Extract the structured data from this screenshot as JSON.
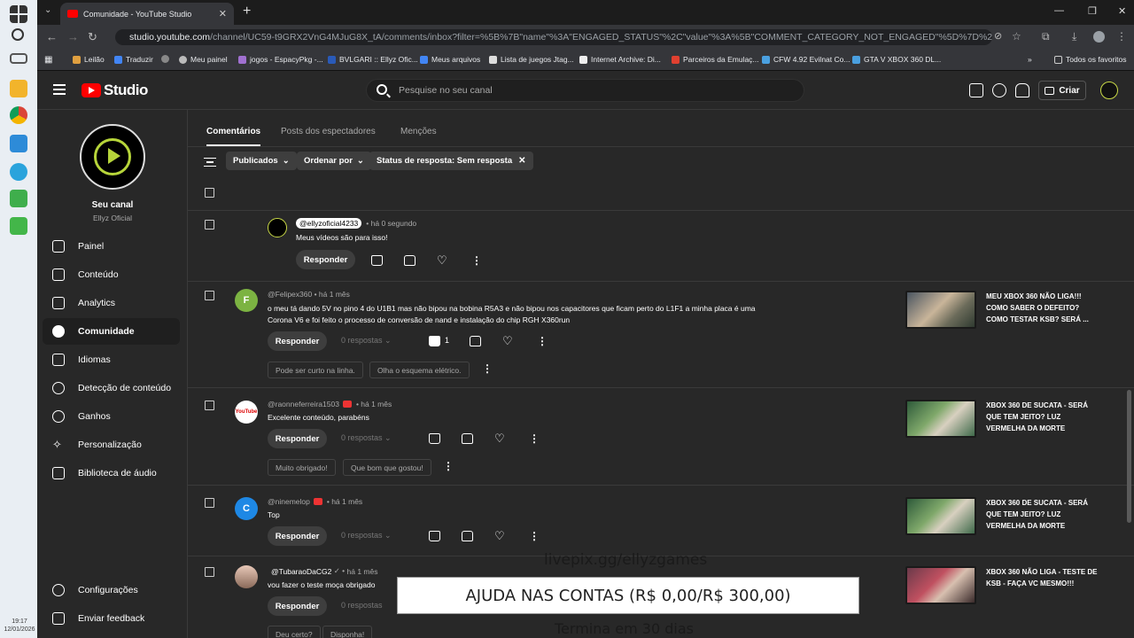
{
  "taskbar": {
    "time": "19:17",
    "date": "12/01/2026"
  },
  "browser": {
    "tab_title": "Comunidade - YouTube Studio",
    "url_host": "studio.youtube.com",
    "url_path": "/channel/UC59-t9GRX2VnG4MJuG8X_tA/comments/inbox?filter=%5B%7B\"name\"%3A\"ENGAGED_STATUS\"%2C\"value\"%3A%5B\"COMMENT_CATEGORY_NOT_ENGAGED\"%5D%7D%2C%7B\"isPinned\"%3Atrue%2C\"na...",
    "bookmarks": [
      "Leilão",
      "Traduzir",
      "Meu painel",
      "jogos - EspacyPkg -...",
      "BVLGARI :: Ellyz Ofic...",
      "Meus arquivos",
      "Lista de juegos Jtag...",
      "Internet Archive: Di...",
      "Parceiros da Emulaç...",
      "CFW 4.92 Evilnat Co...",
      "GTA V XBOX 360 DL..."
    ],
    "bookmarks_all": "Todos os favoritos"
  },
  "header": {
    "logo_text": "Studio",
    "search_placeholder": "Pesquise no seu canal",
    "create_label": "Criar"
  },
  "channel": {
    "name": "Seu canal",
    "handle": "Ellyz Oficial"
  },
  "nav": {
    "items": [
      "Painel",
      "Conteúdo",
      "Analytics",
      "Comunidade",
      "Idiomas",
      "Detecção de conteúdo",
      "Ganhos",
      "Personalização",
      "Biblioteca de áudio"
    ],
    "active": "Comunidade",
    "settings": "Configurações",
    "feedback": "Enviar feedback"
  },
  "tabs": [
    "Comentários",
    "Posts dos espectadores",
    "Menções"
  ],
  "filters": {
    "published": "Publicados",
    "sort": "Ordenar por",
    "status": "Status de resposta: Sem resposta"
  },
  "labels": {
    "reply": "Responder"
  },
  "comments": [
    {
      "author": "@ellyzoficial4233",
      "time": "há 0 segundo",
      "text": "Meus vídeos são para isso!"
    },
    {
      "author": "@Felipex360",
      "time": "há 1 mês",
      "avatar_letter": "F",
      "avatar_color": "#7cb342",
      "text1": "o meu tá dando 5V no pino 4 do U1B1 mas não bipou na bobina R5A3 e não bipou nos capacitores que ficam perto do L1F1 a minha placa é uma",
      "text2": "Corona V6 e foi feito o processo de conversão de nand e instalação do chip RGH X360run",
      "replies": "0 respostas",
      "likes": "1",
      "suggestions": [
        "Pode ser curto na linha.",
        "Olha o esquema elétrico."
      ],
      "video_title": "MEU XBOX 360 NÃO LIGA!!! COMO SABER O DEFEITO? COMO TESTAR KSB? SERÁ ..."
    },
    {
      "author": "@raonneferreira1503",
      "time": "há 1 mês",
      "avatar_label": "YouTube",
      "text": "Excelente conteúdo, parabéns",
      "replies": "0 respostas",
      "suggestions": [
        "Muito obrigado!",
        "Que bom que gostou!"
      ],
      "video_title": "XBOX 360 DE SUCATA - SERÁ QUE TEM JEITO? LUZ VERMELHA DA MORTE"
    },
    {
      "author": "@ninemelop",
      "time": "há 1 mês",
      "avatar_letter": "C",
      "avatar_color": "#1e88e5",
      "text": "Top",
      "replies": "0 respostas",
      "video_title": "XBOX 360 DE SUCATA - SERÁ QUE TEM JEITO? LUZ VERMELHA DA MORTE"
    },
    {
      "author": "@TubaraoDaCG2",
      "time": "há 1 mês",
      "text": "vou fazer o teste moça obrigado",
      "replies": "0 respostas",
      "suggestions": [
        "Deu certo?",
        "Disponha!"
      ],
      "video_title": "XBOX 360 NÃO LIGA - TESTE DE KSB - FAÇA VC MESMO!!!"
    }
  ],
  "overlay": {
    "url": "livepix.gg/ellyzgames",
    "goal": "AJUDA NAS CONTAS (R$ 0,00/R$ 300,00)",
    "ends": "Termina em 30 dias"
  }
}
